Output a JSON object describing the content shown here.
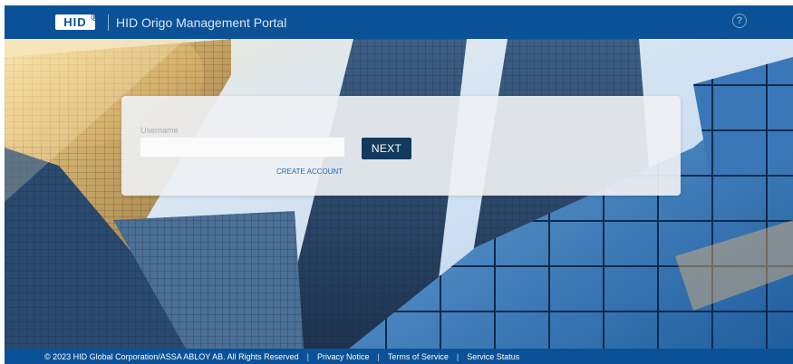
{
  "header": {
    "logo_text": "HID",
    "logo_reg": "®",
    "title": "HID Origo Management Portal",
    "help_icon": "?"
  },
  "login": {
    "username_label": "Username",
    "username_value": "",
    "next_label": "NEXT",
    "create_account_label": "CREATE ACCOUNT"
  },
  "footer": {
    "copyright": "© 2023 HID Global Corporation/ASSA ABLOY AB. All Rights Reserved",
    "separator": "|",
    "links": [
      "Privacy Notice",
      "Terms of Service",
      "Service Status"
    ]
  },
  "colors": {
    "brand_blue": "#0b5197",
    "button_navy": "#123a5e",
    "link_blue": "#2a66a8"
  },
  "icons": {
    "help": "help-circle-icon",
    "logo": "hid-logo"
  }
}
